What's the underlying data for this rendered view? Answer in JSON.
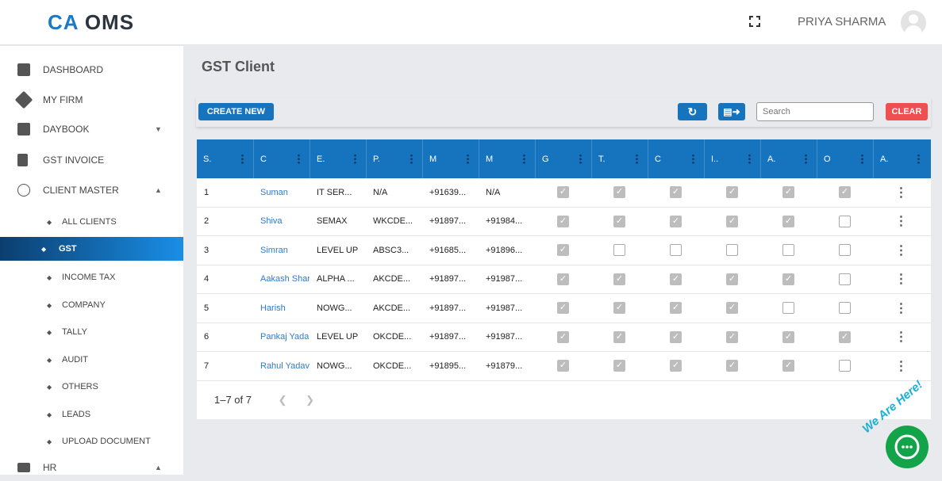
{
  "header": {
    "logo_ca": "CA",
    "logo_text": "OMS",
    "user": "PRIYA SHARMA"
  },
  "sidebar": {
    "items": [
      {
        "label": "DASHBOARD"
      },
      {
        "label": "MY FIRM"
      },
      {
        "label": "DAYBOOK"
      },
      {
        "label": "GST INVOICE"
      },
      {
        "label": "CLIENT MASTER"
      }
    ],
    "sub": [
      {
        "label": "ALL CLIENTS"
      },
      {
        "label": "GST"
      },
      {
        "label": "INCOME TAX"
      },
      {
        "label": "COMPANY"
      },
      {
        "label": "TALLY"
      },
      {
        "label": "AUDIT"
      },
      {
        "label": "OTHERS"
      },
      {
        "label": "LEADS"
      },
      {
        "label": "UPLOAD DOCUMENT"
      }
    ],
    "hr": "HR"
  },
  "page": {
    "title": "GST Client",
    "create": "CREATE NEW",
    "search_placeholder": "Search",
    "clear": "CLEAR",
    "colors": {
      "primary": "#1673be",
      "clear": "#ef4f4f"
    }
  },
  "table": {
    "headers": [
      "S.",
      "C",
      "E.",
      "P.",
      "M",
      "M",
      "G",
      "T.",
      "C",
      "I..",
      "A.",
      "O",
      "A."
    ],
    "rows": [
      {
        "s": "1",
        "c": "Suman",
        "e": "IT SER...",
        "p": "N/A",
        "m1": "+91639...",
        "m2": "N/A",
        "checks": [
          1,
          1,
          1,
          1,
          1,
          1
        ]
      },
      {
        "s": "2",
        "c": "Shiva",
        "e": "SEMAX",
        "p": "WKCDE...",
        "m1": "+91897...",
        "m2": "+91984...",
        "checks": [
          1,
          1,
          1,
          1,
          1,
          0
        ]
      },
      {
        "s": "3",
        "c": "Simran",
        "e": "LEVEL UP",
        "p": "ABSC3...",
        "m1": "+91685...",
        "m2": "+91896...",
        "checks": [
          1,
          0,
          0,
          0,
          0,
          0
        ]
      },
      {
        "s": "4",
        "c": "Aakash Shar",
        "e": "ALPHA ...",
        "p": "AKCDE...",
        "m1": "+91897...",
        "m2": "+91987...",
        "checks": [
          1,
          1,
          1,
          1,
          1,
          0
        ]
      },
      {
        "s": "5",
        "c": "Harish",
        "e": "NOWG...",
        "p": "AKCDE...",
        "m1": "+91897...",
        "m2": "+91987...",
        "checks": [
          1,
          1,
          1,
          1,
          0,
          0
        ]
      },
      {
        "s": "6",
        "c": "Pankaj Yada",
        "e": "LEVEL UP",
        "p": "OKCDE...",
        "m1": "+91897...",
        "m2": "+91987...",
        "checks": [
          1,
          1,
          1,
          1,
          1,
          1
        ]
      },
      {
        "s": "7",
        "c": "Rahul Yadav",
        "e": "NOWG...",
        "p": "OKCDE...",
        "m1": "+91895...",
        "m2": "+91879...",
        "checks": [
          1,
          1,
          1,
          1,
          1,
          0
        ]
      }
    ],
    "pager": "1–7 of 7"
  },
  "chat": {
    "text": "We Are Here!"
  }
}
